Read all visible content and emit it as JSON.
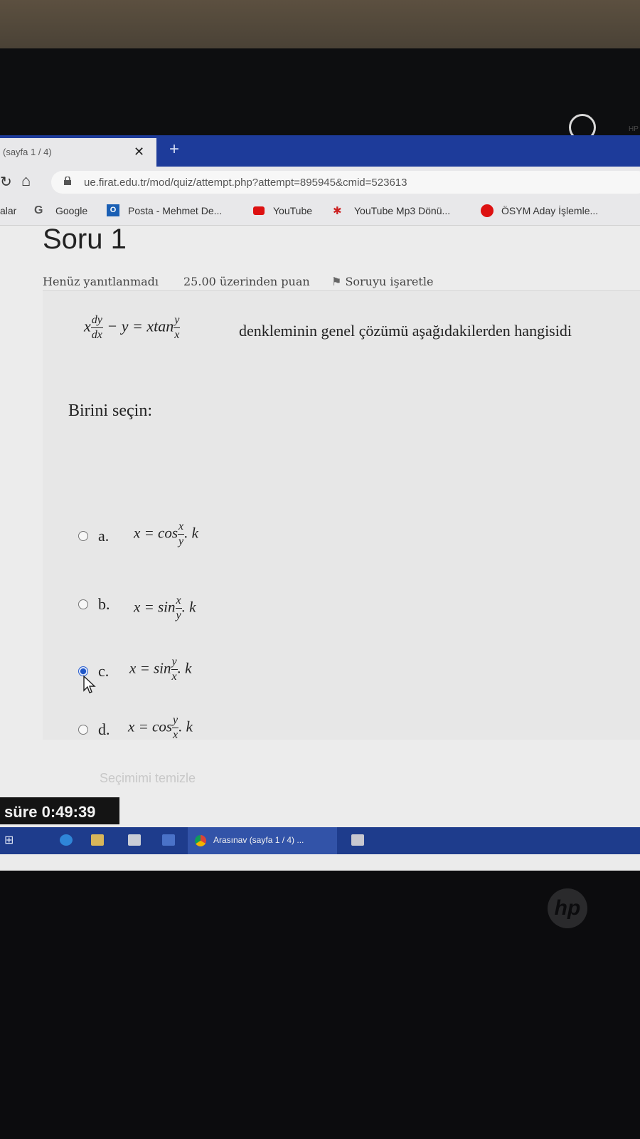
{
  "browser": {
    "tab_title": "(sayfa 1 / 4)",
    "tab_close": "✕",
    "new_tab": "+",
    "url": "ue.firat.edu.tr/mod/quiz/attempt.php?attempt=895945&cmid=523613",
    "bookmarks": [
      {
        "label": "alar",
        "icon": "apps-icon"
      },
      {
        "label": "Google",
        "icon": "google-icon"
      },
      {
        "label": "Posta - Mehmet De...",
        "icon": "outlook-icon"
      },
      {
        "label": "YouTube",
        "icon": "youtube-icon"
      },
      {
        "label": "YouTube Mp3 Dönü...",
        "icon": "audio-wave-icon"
      },
      {
        "label": "ÖSYM Aday İşlemle...",
        "icon": "osym-icon"
      }
    ]
  },
  "question": {
    "title": "Soru 1",
    "status": "Henüz yanıtlanmadı",
    "points": "25.00 üzerinden puan",
    "flag_label": "Soruyu işaretle",
    "equation": {
      "lhs_prefix": "x",
      "dy": "dy",
      "dx": "dx",
      "middle": "− y = xtan",
      "y": "y",
      "x": "x"
    },
    "text": "denkleminin genel çözümü aşağıdakilerden hangisidi",
    "choose_label": "Birini seçin:",
    "options": [
      {
        "letter": "a.",
        "prefix": "x = cos",
        "num": "x",
        "den": "y",
        "suffix": ". k",
        "selected": false
      },
      {
        "letter": "b.",
        "prefix": "x = sin",
        "num": "x",
        "den": "y",
        "suffix": ". k",
        "selected": false
      },
      {
        "letter": "c.",
        "prefix": "x = sin",
        "num": "y",
        "den": "x",
        "suffix": ". k",
        "selected": true
      },
      {
        "letter": "d.",
        "prefix": "x = cos",
        "num": "y",
        "den": "x",
        "suffix": ". k",
        "selected": false
      }
    ],
    "clear_choice": "Seçimimi temizle"
  },
  "timer": "süre 0:49:39",
  "taskbar": {
    "active_window": "Arasınav (sayfa 1 / 4) ..."
  },
  "colors": {
    "tabstrip": "#1d3b9a",
    "taskbar": "#1e3c8c",
    "radio_selected": "#1f57c8"
  }
}
